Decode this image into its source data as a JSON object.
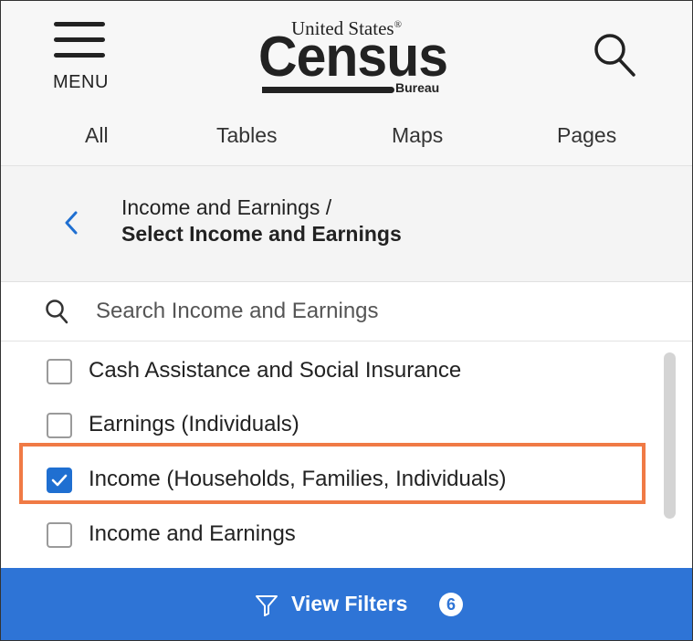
{
  "header": {
    "menu_label": "MENU",
    "logo": {
      "top_text": "United States",
      "registered_mark": "®",
      "main_text": "Census",
      "sub_text": "Bureau"
    },
    "search_icon": "search-icon"
  },
  "tabs": [
    {
      "label": "All"
    },
    {
      "label": "Tables"
    },
    {
      "label": "Maps"
    },
    {
      "label": "Pages"
    }
  ],
  "breadcrumb": {
    "parent": "Income and Earnings /",
    "current": "Select Income and Earnings"
  },
  "search": {
    "placeholder": "Search Income and Earnings",
    "value": ""
  },
  "list": {
    "items": [
      {
        "label": "Cash Assistance and Social Insurance",
        "checked": false
      },
      {
        "label": "Earnings (Individuals)",
        "checked": false
      },
      {
        "label": "Income (Households, Families, Individuals)",
        "checked": true
      },
      {
        "label": "Income and Earnings",
        "checked": false
      }
    ]
  },
  "footer": {
    "label": "View Filters",
    "count": "6",
    "icon": "funnel-icon"
  },
  "colors": {
    "accent": "#2e74d6",
    "checkbox": "#1f6fd1",
    "highlight": "#f07a45"
  }
}
